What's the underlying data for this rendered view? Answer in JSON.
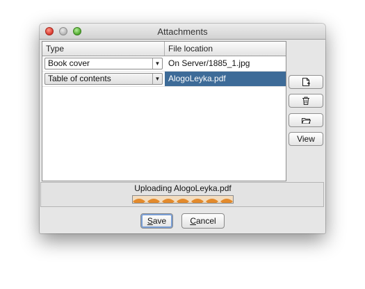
{
  "window": {
    "title": "Attachments"
  },
  "table": {
    "columns": [
      "Type",
      "File location"
    ],
    "rows": [
      {
        "type": "Book cover",
        "file": "On Server/1885_1.jpg",
        "selected": false
      },
      {
        "type": "Table of contents",
        "file": "AlogoLeyka.pdf",
        "selected": true
      }
    ]
  },
  "side_buttons": {
    "new_icon": "new-document-icon",
    "delete_icon": "trash-icon",
    "open_icon": "open-folder-icon",
    "view_label": "View"
  },
  "upload": {
    "status_text": "Uploading AlogoLeyka.pdf",
    "progress_style": "indeterminate",
    "color": "#e38a2c"
  },
  "buttons": {
    "save_mnemonic": "S",
    "save_rest": "ave",
    "cancel_mnemonic": "C",
    "cancel_rest": "ancel"
  },
  "colors": {
    "selection": "#3d6b98",
    "window_bg": "#e6e6e6"
  }
}
